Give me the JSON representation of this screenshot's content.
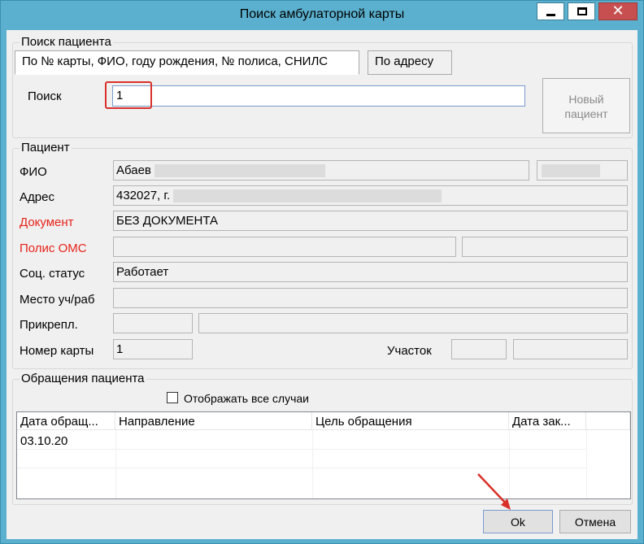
{
  "window": {
    "title": "Поиск амбулаторной карты"
  },
  "search_group": {
    "legend": "Поиск пациента",
    "tabs": [
      {
        "label": "По № карты, ФИО, году рождения, № полиса, СНИЛС"
      },
      {
        "label": "По адресу"
      }
    ],
    "search_label": "Поиск",
    "search_value": "1",
    "new_patient_button": "Новый\nпациент"
  },
  "patient_group": {
    "legend": "Пациент",
    "fio_label": "ФИО",
    "fio_value": "Абаев",
    "address_label": "Адрес",
    "address_value": "432027, г.",
    "document_label": "Документ",
    "document_value": "БЕЗ ДОКУМЕНТА",
    "policy_label": "Полис ОМС",
    "social_label": "Соц. статус",
    "social_value": "Работает",
    "workplace_label": "Место уч/раб",
    "attach_label": "Прикрепл.",
    "card_label": "Номер карты",
    "card_value": "1",
    "district_label": "Участок"
  },
  "visits_group": {
    "legend": "Обращения пациента",
    "show_all_label": "Отображать все случаи",
    "columns": [
      "Дата обращ...",
      "Направление",
      "Цель обращения",
      "Дата зак..."
    ],
    "rows": [
      [
        "03.10.20",
        "",
        "",
        ""
      ]
    ]
  },
  "buttons": {
    "ok": "Ok",
    "cancel": "Отмена"
  },
  "colors": {
    "titlebar": "#5ab0ce",
    "required_label": "#e8231a",
    "annotation": "#d9302a"
  }
}
